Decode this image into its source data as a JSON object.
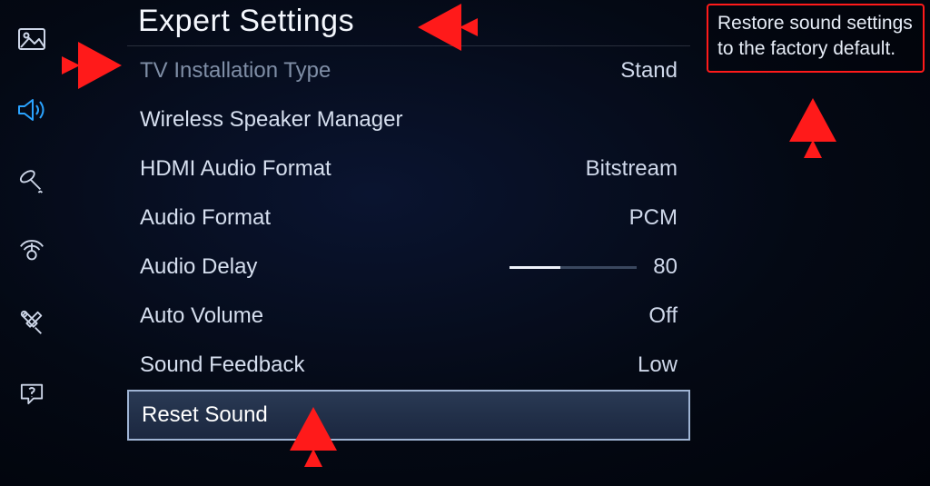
{
  "title": "Expert Settings",
  "help_text": "Restore sound settings to the factory default.",
  "sidebar": {
    "items": [
      {
        "name": "picture",
        "active": false
      },
      {
        "name": "sound",
        "active": true
      },
      {
        "name": "broadcast",
        "active": false
      },
      {
        "name": "network",
        "active": false
      },
      {
        "name": "system",
        "active": false
      },
      {
        "name": "support",
        "active": false
      }
    ]
  },
  "rows": [
    {
      "label": "TV Installation Type",
      "value": "Stand",
      "dimmed": true,
      "selected": false
    },
    {
      "label": "Wireless Speaker Manager",
      "value": "",
      "dimmed": false,
      "selected": false
    },
    {
      "label": "HDMI Audio Format",
      "value": "Bitstream",
      "dimmed": false,
      "selected": false
    },
    {
      "label": "Audio Format",
      "value": "PCM",
      "dimmed": false,
      "selected": false
    },
    {
      "label": "Audio Delay",
      "value": "80",
      "slider_percent": 40,
      "dimmed": false,
      "selected": false
    },
    {
      "label": "Auto Volume",
      "value": "Off",
      "dimmed": false,
      "selected": false
    },
    {
      "label": "Sound Feedback",
      "value": "Low",
      "dimmed": false,
      "selected": false
    },
    {
      "label": "Reset Sound",
      "value": "",
      "dimmed": false,
      "selected": true
    }
  ],
  "colors": {
    "annotation": "#ff1a1a",
    "accent": "#2aa3ff"
  }
}
